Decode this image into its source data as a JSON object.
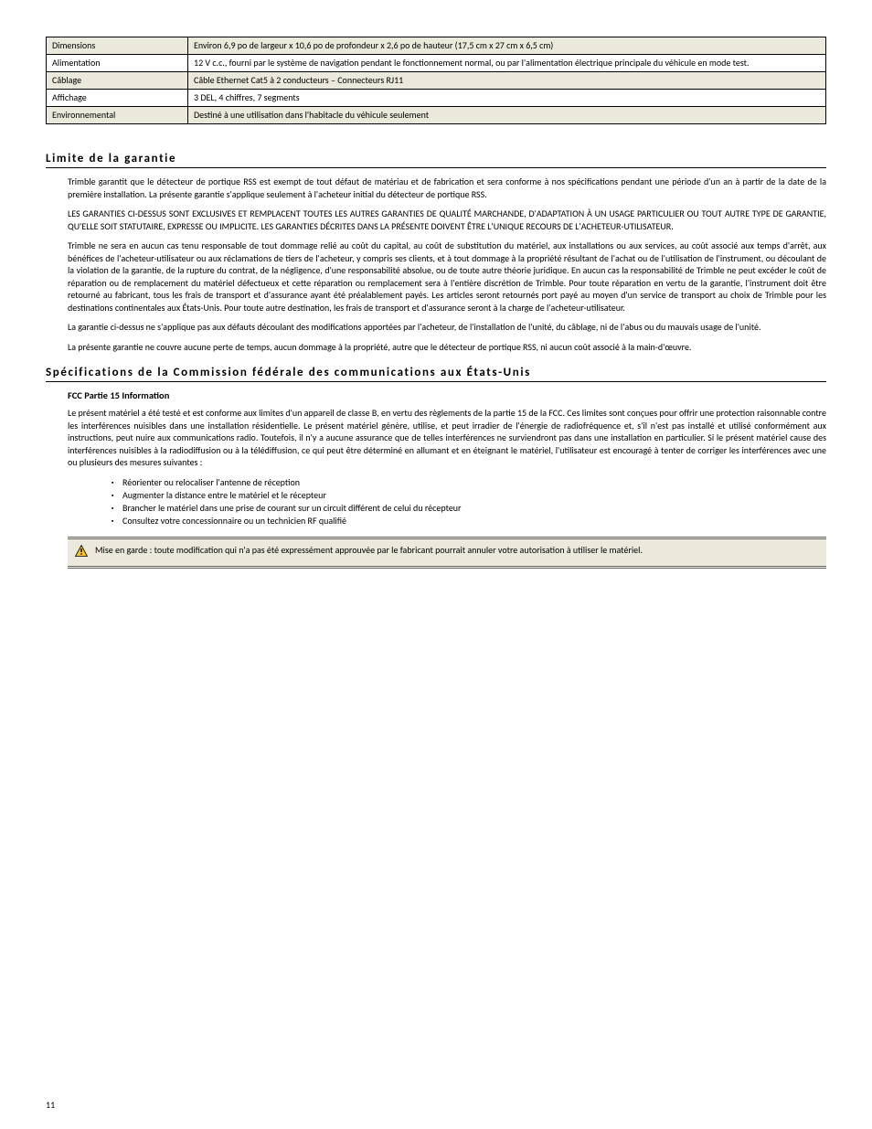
{
  "table": {
    "rows": [
      {
        "label": "Dimensions",
        "value": "Environ 6,9 po de largeur x 10,6 po de profondeur x 2,6 po de hauteur (17,5 cm x 27 cm x 6,5 cm)"
      },
      {
        "label": "Alimentation",
        "value": "12 V c.c., fourni par le système de navigation pendant le fonctionnement normal, ou par l'alimentation électrique principale du véhicule en mode test."
      },
      {
        "label": "Câblage",
        "value": "Câble Ethernet Cat5 à 2 conducteurs – Connecteurs RJ11"
      },
      {
        "label": "Affichage",
        "value": "3 DEL, 4 chiffres, 7 segments"
      },
      {
        "label": "Environnemental",
        "value": "Destiné à une utilisation dans l'habitacle du véhicule seulement"
      }
    ]
  },
  "warranty": {
    "heading": "Limite de la garantie",
    "p1": "Trimble garantit que le détecteur de portique RSS est exempt de tout défaut de matériau et de fabrication et sera conforme à nos spécifications pendant une période d'un an à partir de la date de la première installation. La présente garantie s'applique seulement à l'acheteur initial du détecteur de portique RSS.",
    "p2": "LES GARANTIES CI-DESSUS SONT EXCLUSIVES ET REMPLACENT TOUTES LES AUTRES GARANTIES DE QUALITÉ MARCHANDE, D'ADAPTATION À UN USAGE PARTICULIER OU TOUT AUTRE TYPE DE GARANTIE, QU'ELLE SOIT STATUTAIRE, EXPRESSE OU IMPLICITE. LES GARANTIES DÉCRITES DANS LA PRÉSENTE DOIVENT ÊTRE L'UNIQUE RECOURS DE L'ACHETEUR-UTILISATEUR.",
    "p3": "Trimble ne sera en aucun cas tenu responsable de tout dommage relié au coût du capital, au coût de substitution du matériel, aux installations ou aux services, au coût associé aux temps d'arrêt, aux bénéfices de l'acheteur-utilisateur ou aux réclamations de tiers de l'acheteur, y compris ses clients, et à tout dommage à la propriété résultant de l'achat ou de l'utilisation de l'instrument, ou découlant de la violation de la garantie, de la rupture du contrat, de la négligence, d'une responsabilité absolue, ou de toute autre théorie juridique. En aucun cas la responsabilité de Trimble ne peut excéder le coût de réparation ou de remplacement du matériel défectueux et cette réparation ou remplacement sera à l'entière discrétion de Trimble. Pour toute réparation en vertu de la garantie, l'instrument doit être retourné au fabricant, tous les frais de transport et d'assurance ayant été préalablement payés. Les articles seront retournés port payé au moyen d'un service de transport au choix de Trimble pour les destinations continentales aux États-Unis. Pour toute autre destination, les frais de transport et d'assurance seront à la charge de l'acheteur-utilisateur.",
    "p4": "La garantie ci-dessus ne s'applique pas aux défauts découlant des modifications apportées par l'acheteur, de l'installation de l'unité, du câblage, ni de l'abus ou du mauvais usage de l'unité.",
    "p5": "La présente garantie ne couvre aucune perte de temps, aucun dommage à la propriété, autre que le détecteur de portique RSS, ni aucun coût associé à la main-d'œuvre."
  },
  "fcc": {
    "heading": "Spécifications de la Commission fédérale des communications aux États-Unis",
    "subhead": "FCC Partie 15 Information",
    "p1": "Le présent matériel a été testé et est conforme aux limites d'un appareil de classe B, en vertu des règlements de la partie 15 de la FCC. Ces limites sont conçues pour offrir une protection raisonnable contre les interférences nuisibles dans une installation résidentielle. Le présent matériel génère, utilise, et peut irradier de l'énergie de radiofréquence et, s'il n'est pas installé et utilisé conformément aux instructions, peut nuire aux communications radio. Toutefois, il n'y a aucune assurance que de telles interférences ne surviendront pas dans une installation en particulier. Si le présent matériel cause des interférences nuisibles à la radiodiffusion ou à la télédiffusion, ce qui peut être déterminé en allumant et en éteignant le matériel, l'utilisateur est encouragé à tenter de corriger les interférences avec une ou plusieurs des mesures suivantes :",
    "measures": [
      "Réorienter ou relocaliser l'antenne de réception",
      "Augmenter la distance entre le matériel et le récepteur",
      "Brancher le matériel dans une prise de courant sur un circuit différent de celui du récepteur",
      "Consultez votre concessionnaire ou un technicien RF qualifié"
    ],
    "caution": "Mise en garde : toute modification qui n'a pas été expressément approuvée par le fabricant pourrait annuler votre autorisation à utiliser le matériel."
  },
  "page_number": "11"
}
